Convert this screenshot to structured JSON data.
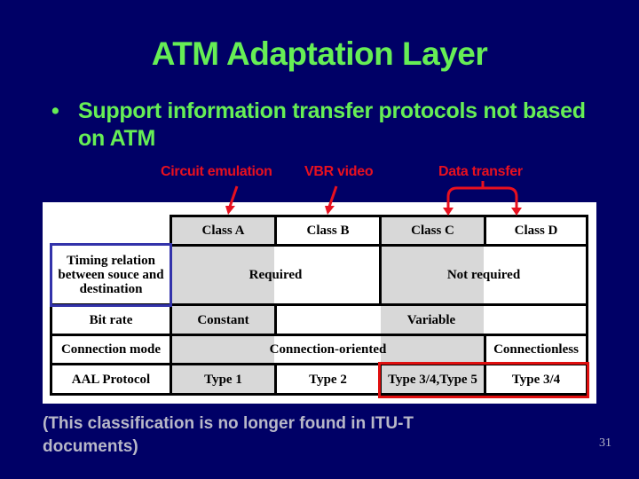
{
  "slide": {
    "title": "ATM Adaptation Layer",
    "bullet_marker": "•",
    "bullet_text": "Support information transfer protocols not based on ATM",
    "note": "(This classification is no longer found in ITU-T documents)",
    "page_number": "31"
  },
  "annotations": {
    "circuit_emulation": "Circuit emulation",
    "vbr_video": "VBR video",
    "data_transfer": "Data transfer",
    "color": "#e8101f"
  },
  "table": {
    "headers": [
      "Class A",
      "Class B",
      "Class C",
      "Class D"
    ],
    "rows": {
      "timing": {
        "label": "Timing relation between souce and destination",
        "ab": "Required",
        "cd": "Not required"
      },
      "bitrate": {
        "label": "Bit rate",
        "a": "Constant",
        "bcd": "Variable"
      },
      "connection": {
        "label": "Connection mode",
        "abc": "Connection-oriented",
        "d": "Connectionless"
      },
      "aal": {
        "label": "AAL Protocol",
        "a": "Type 1",
        "b": "Type 2",
        "c": "Type 3/4,Type 5",
        "d": "Type 3/4"
      }
    },
    "highlight_colors": {
      "row_label_box": "#3333aa",
      "protocol_box": "#e01010",
      "shaded_columns": "#d8d8d8"
    }
  }
}
